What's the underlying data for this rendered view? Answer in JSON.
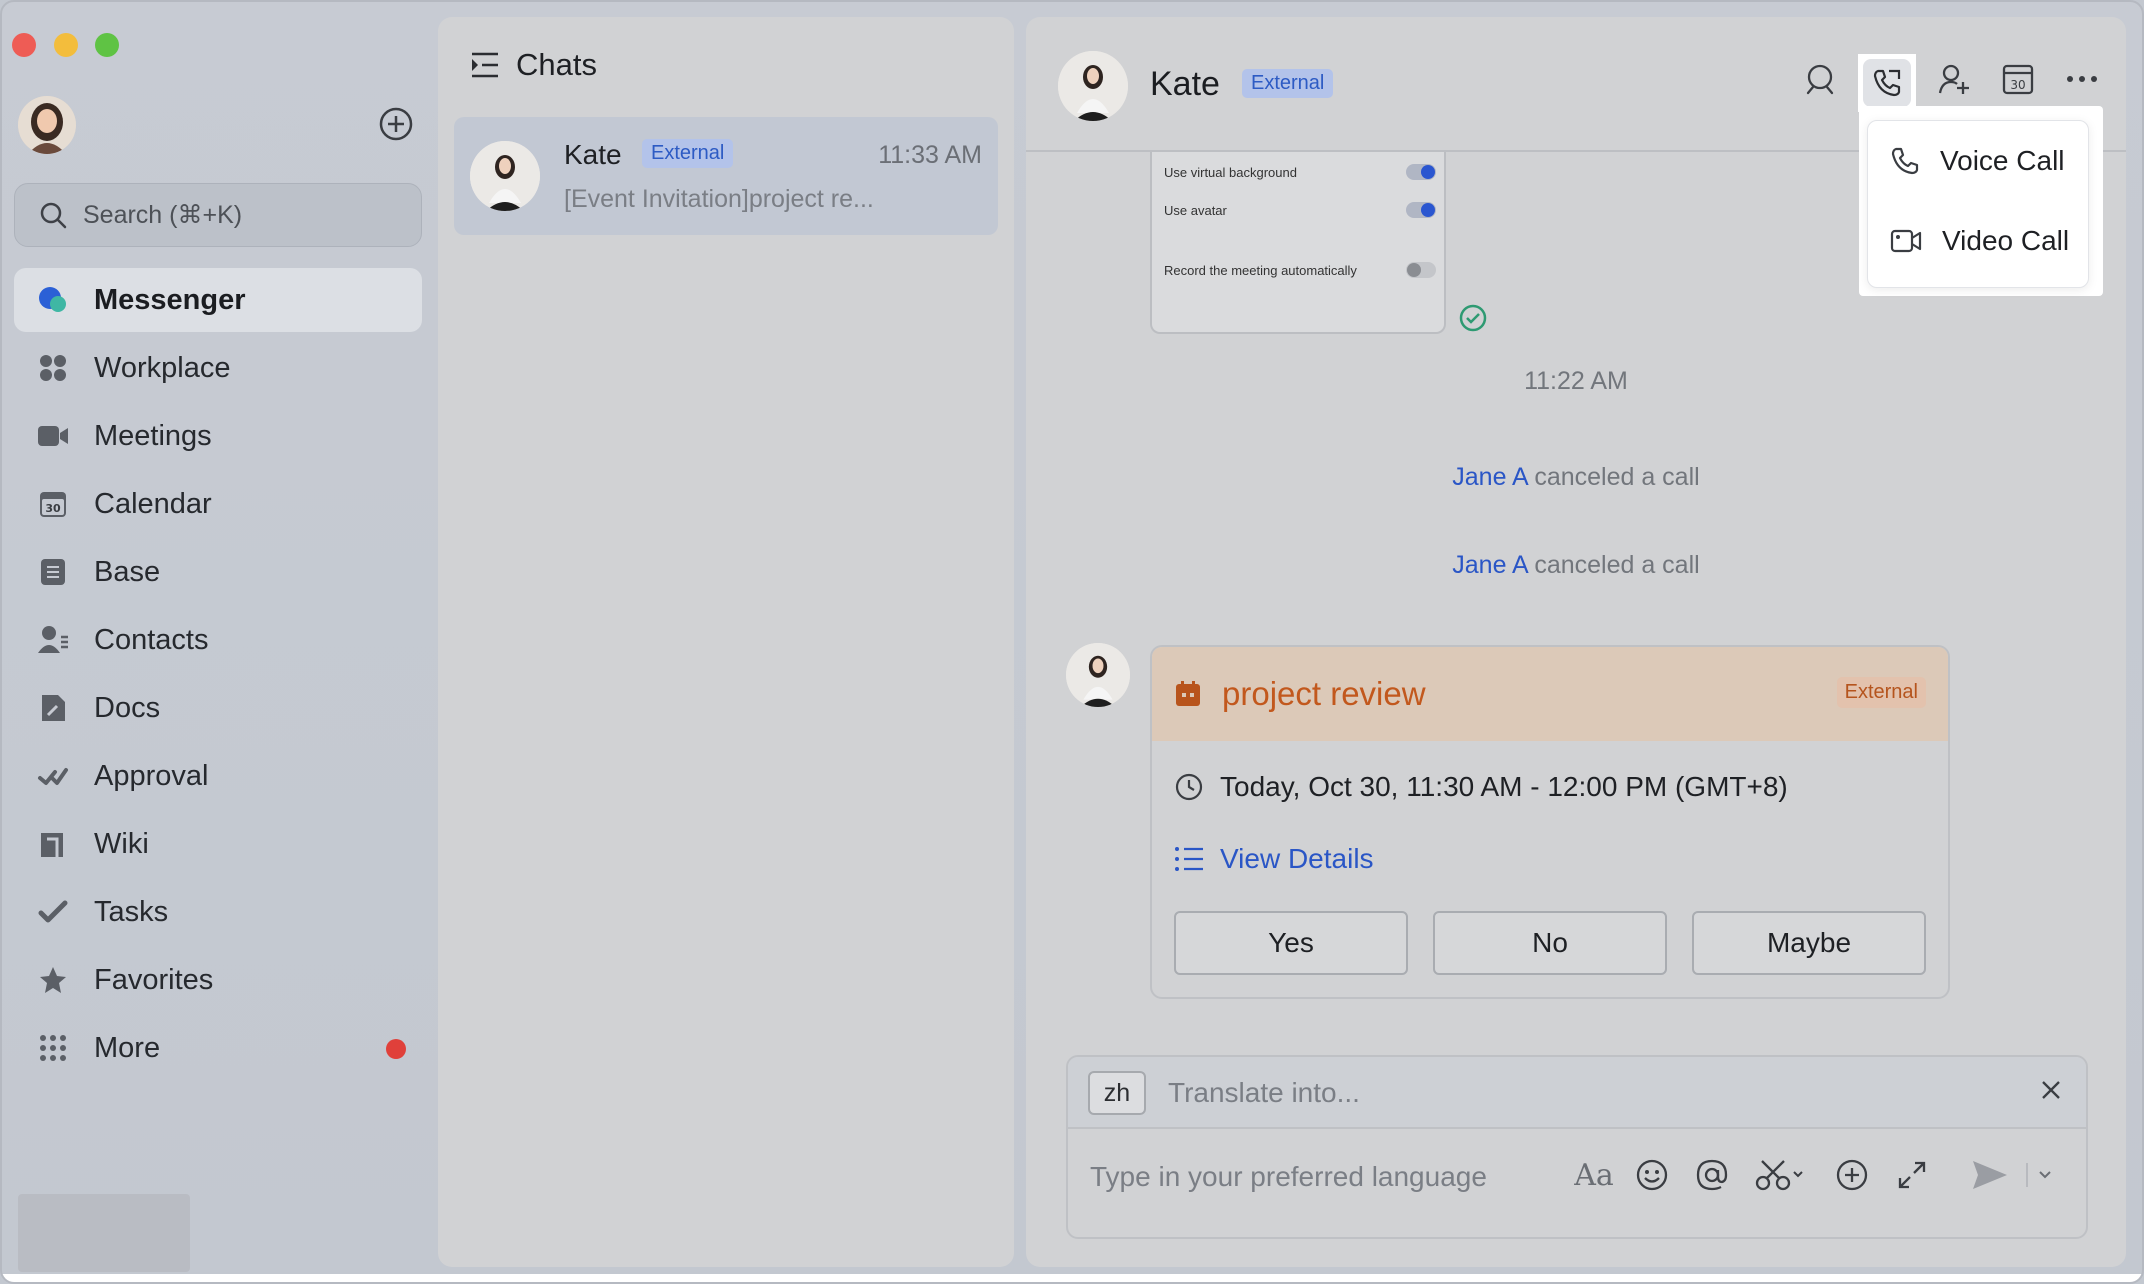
{
  "sidebar": {
    "search_placeholder": "Search (⌘+K)",
    "items": [
      {
        "label": "Messenger",
        "icon": "messenger-icon"
      },
      {
        "label": "Workplace",
        "icon": "workplace-icon"
      },
      {
        "label": "Meetings",
        "icon": "meetings-icon"
      },
      {
        "label": "Calendar",
        "icon": "calendar-icon"
      },
      {
        "label": "Base",
        "icon": "base-icon"
      },
      {
        "label": "Contacts",
        "icon": "contacts-icon"
      },
      {
        "label": "Docs",
        "icon": "docs-icon"
      },
      {
        "label": "Approval",
        "icon": "approval-icon"
      },
      {
        "label": "Wiki",
        "icon": "wiki-icon"
      },
      {
        "label": "Tasks",
        "icon": "tasks-icon"
      },
      {
        "label": "Favorites",
        "icon": "favorites-icon"
      },
      {
        "label": "More",
        "icon": "more-apps-icon"
      }
    ],
    "calendar_icon_day": "30"
  },
  "chatlist": {
    "title": "Chats",
    "chats": [
      {
        "name": "Kate",
        "badge": "External",
        "time": "11:33 AM",
        "preview": "[Event Invitation]project re..."
      }
    ]
  },
  "conversation": {
    "name": "Kate",
    "badge": "External",
    "header_calendar_day": "30",
    "call_menu": {
      "voice": "Voice Call",
      "video": "Video Call"
    },
    "screenshot_rows": [
      "Use virtual background",
      "Use avatar",
      "Record the meeting automatically"
    ],
    "timestamp": "11:22 AM",
    "system_messages": [
      {
        "who": "Jane A",
        "text": "canceled a call"
      },
      {
        "who": "Jane A",
        "text": "canceled a call"
      }
    ],
    "event_card": {
      "title": "project review",
      "badge": "External",
      "time": "Today, Oct 30, 11:30 AM - 12:00 PM (GMT+8)",
      "details_link": "View Details",
      "rsvp": {
        "yes": "Yes",
        "no": "No",
        "maybe": "Maybe"
      }
    },
    "composer": {
      "lang": "zh",
      "translate_placeholder": "Translate into...",
      "input_placeholder": "Type in your preferred language",
      "format_label": "Aa"
    }
  },
  "colors": {
    "accent_blue": "#2a56c6",
    "event_orange": "#c2581d",
    "notification_red": "#e0403a"
  }
}
